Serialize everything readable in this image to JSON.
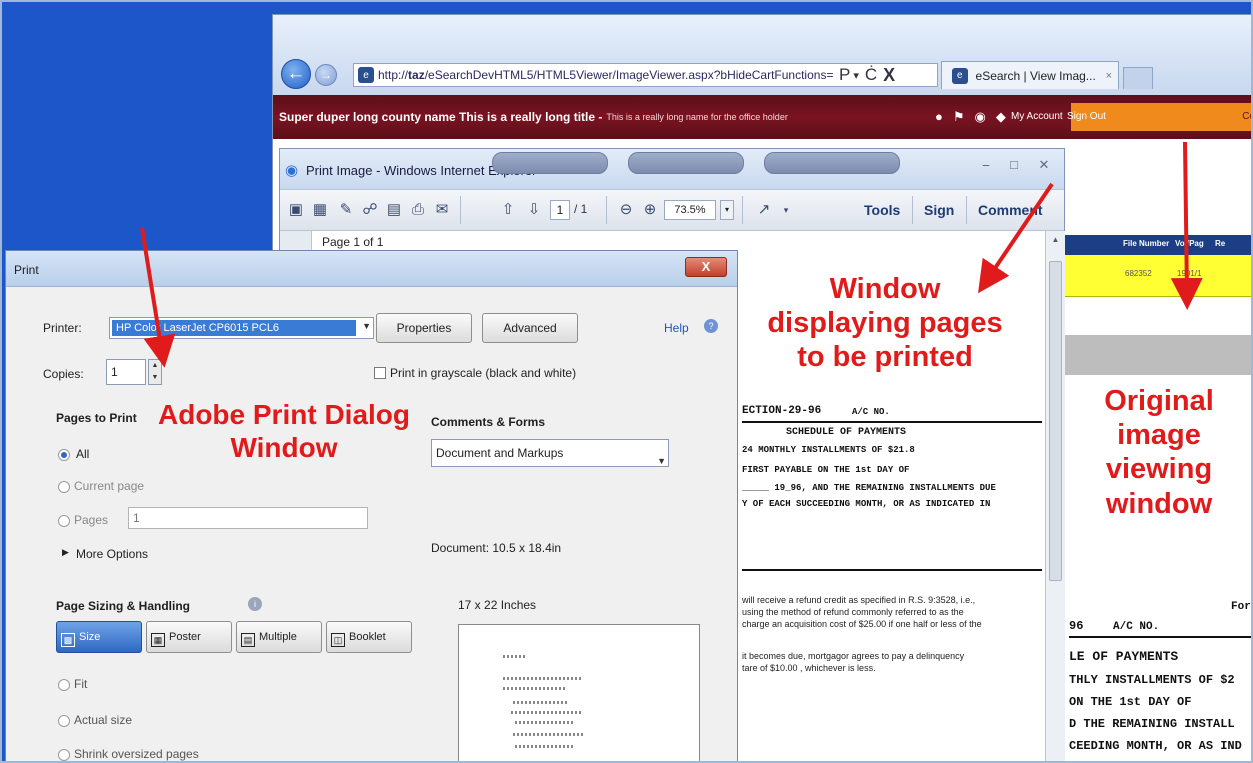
{
  "browser": {
    "url_prefix": "http://",
    "url_host": "taz",
    "url_path": "/eSearchDevHTML5/HTML5Viewer/ImageViewer.aspx?bHideCartFunctions=",
    "tab_title": "eSearch | View Imag...",
    "tab_close": "×",
    "search_icon": "Ρ",
    "refresh_icon": "Ċ",
    "stop_icon": "X"
  },
  "site_header": {
    "title": "Super duper long county name This is a really long title -",
    "subtitle": "This is a really long name for the office holder",
    "my_account": "My Account",
    "sign_out": "Sign Out",
    "orange_text": "Co"
  },
  "results": {
    "col_file_number": "File Number",
    "col_vol_pag": "Vol/Pag",
    "col_extra": "Re",
    "file_number": "682352",
    "vol_pag": "1901/1"
  },
  "print_image_window": {
    "title": "Print Image - Windows Internet Explorer",
    "page_current": "1",
    "page_total": "/ 1",
    "zoom": "73.5%",
    "tools": "Tools",
    "sign": "Sign",
    "comment": "Comment",
    "page_indicator": "Page 1 of 1"
  },
  "scanned_doc": {
    "line1": "ECTION-29-96",
    "line1b": "A/C NO.",
    "line2": "SCHEDULE OF PAYMENTS",
    "line3": "24      MONTHLY INSTALLMENTS OF $21.8",
    "line4": "FIRST PAYABLE ON THE 1st     DAY OF",
    "line5": "_____ 19_96, AND THE REMAINING INSTALLMENTS DUE",
    "line6": "Y OF EACH SUCCEEDING MONTH, OR AS INDICATED IN",
    "para1": "will receive a refund credit as specified in R.S. 9:3528, i.e.,",
    "para2": "using the method of refund commonly referred to as the",
    "para3": "charge an acquisition cost of $25.00 if one half or less of the",
    "para4": "it becomes due, mortgagor agrees to pay a delinquency",
    "para5": "tare of $10.00 , whichever is less.",
    "orig1": "96",
    "orig1b": "A/C NO.",
    "orig_for": "For",
    "orig2": "LE OF PAYMENTS",
    "orig3": "THLY INSTALLMENTS OF $2",
    "orig4": "ON THE 1st      DAY OF",
    "orig5": "D THE REMAINING INSTALL",
    "orig6": "CEEDING MONTH, OR AS IND"
  },
  "print_dialog": {
    "title": "Print",
    "close": "X",
    "printer_label": "Printer:",
    "printer_value": "HP Color LaserJet CP6015 PCL6",
    "properties": "Properties",
    "advanced": "Advanced",
    "help": "Help",
    "copies_label": "Copies:",
    "copies_value": "1",
    "grayscale": "Print in grayscale (black and white)",
    "pages_to_print": "Pages to Print",
    "all": "All",
    "current_page": "Current page",
    "pages": "Pages",
    "pages_value": "1",
    "more_options": "More Options",
    "comments_forms": "Comments & Forms",
    "comments_value": "Document and Markups",
    "document_size": "Document: 10.5 x 18.4in",
    "page_sizing": "Page Sizing & Handling",
    "size": "Size",
    "poster": "Poster",
    "multiple": "Multiple",
    "booklet": "Booklet",
    "paper_size": "17 x 22 Inches",
    "fit": "Fit",
    "actual_size": "Actual size",
    "shrink": "Shrink oversized pages"
  },
  "annotations": {
    "adobe_1": "Adobe Print Dialog",
    "adobe_2": "Window",
    "window_1": "Window",
    "window_2": "displaying pages",
    "window_3": "to be printed",
    "orig_1": "Original",
    "orig_2": "image",
    "orig_3": "viewing",
    "orig_4": "window"
  },
  "colors": {
    "annotation_red": "#e01b1b",
    "desktop_blue": "#1d56c8",
    "header_maroon": "#6a111c",
    "result_yellow": "#ffff33"
  }
}
